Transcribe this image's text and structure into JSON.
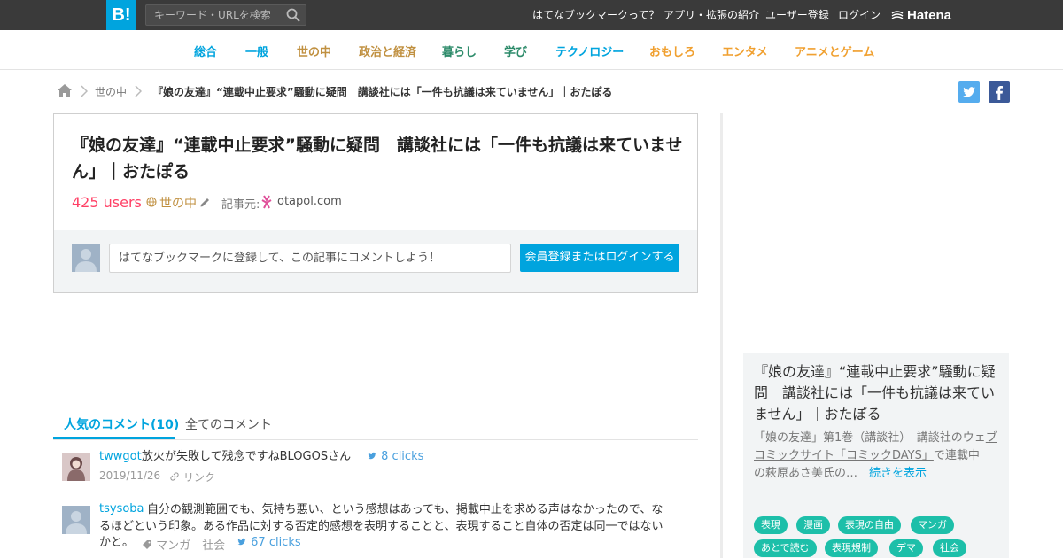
{
  "header": {
    "logo_text": "B!",
    "search_placeholder": "キーワード・URLを検索",
    "nav": [
      "はてなブックマークって？",
      "アプリ・拡張の紹介",
      "ユーザー登録",
      "ログイン"
    ],
    "brand": "Hatena"
  },
  "categories": [
    {
      "label": "総合",
      "color": "#00a4de"
    },
    {
      "label": "一般",
      "color": "#00a4de"
    },
    {
      "label": "世の中",
      "color": "#c09040"
    },
    {
      "label": "政治と経済",
      "color": "#c09040"
    },
    {
      "label": "暮らし",
      "color": "#2d8b6a"
    },
    {
      "label": "学び",
      "color": "#2d8b6a"
    },
    {
      "label": "テクノロジー",
      "color": "#00a4de"
    },
    {
      "label": "おもしろ",
      "color": "#f0a030"
    },
    {
      "label": "エンタメ",
      "color": "#f0a030"
    },
    {
      "label": "アニメとゲーム",
      "color": "#f0a030"
    }
  ],
  "breadcrumb": {
    "category": "世の中",
    "title": "『娘の友達』“連載中止要求”騒動に疑問　講談社には「一件も抗議は来ていません」｜おたぽる"
  },
  "entry": {
    "title": "『娘の友達』“連載中止要求”騒動に疑問　講談社には「一件も抗議は来ていません」｜おたぽる",
    "users": "425 users",
    "category": "世の中",
    "source_label": "記事元:",
    "source_domain": "otapol.com",
    "comment_placeholder": "はてなブックマークに登録して、この記事にコメントしよう！",
    "login_button": "会員登録またはログインする"
  },
  "tabs": {
    "popular": "人気のコメント(10)",
    "all": "全てのコメント"
  },
  "comments": [
    {
      "user": "twwgot",
      "text": "放火が失敗して残念ですねBLOGOSさん",
      "clicks": "8 clicks",
      "date": "2019/11/26",
      "link": "リンク"
    },
    {
      "user": "tsysoba",
      "text_line1": "自分の観測範囲でも、気持ち悪い、という感想はあっても、掲載中止を求める声はなかったので、な",
      "text_line2": "るほどという印象。ある作品に対する否定的感想を表明することと、表現すること自体の否定は同一ではない",
      "text_line3": "かと。",
      "tags": "マンガ　社会",
      "clicks": "67 clicks"
    }
  ],
  "sidebar": {
    "title": "『娘の友達』“連載中止要求”騒動に疑問　講談社には「一件も抗議は来ていません」｜おたぽる",
    "desc_pre": "「娘の友達」第1巻（講談社）　講談社のウェ",
    "desc_link1": "ブコミックサイト",
    "desc_link2": "「コミックDAYS」",
    "desc_mid": "で連載中",
    "desc_post": "の萩原あさ美氏の…",
    "more": "続きを表示",
    "tags": [
      "表現",
      "漫画",
      "表現の自由",
      "マンガ",
      "あとで読む",
      "表現規制",
      "デマ",
      "社会"
    ]
  },
  "colors": {
    "accent": "#00a4de",
    "users": "#ff4166",
    "tag": "#1dbfa9",
    "header_bg": "#3a3a3a"
  }
}
